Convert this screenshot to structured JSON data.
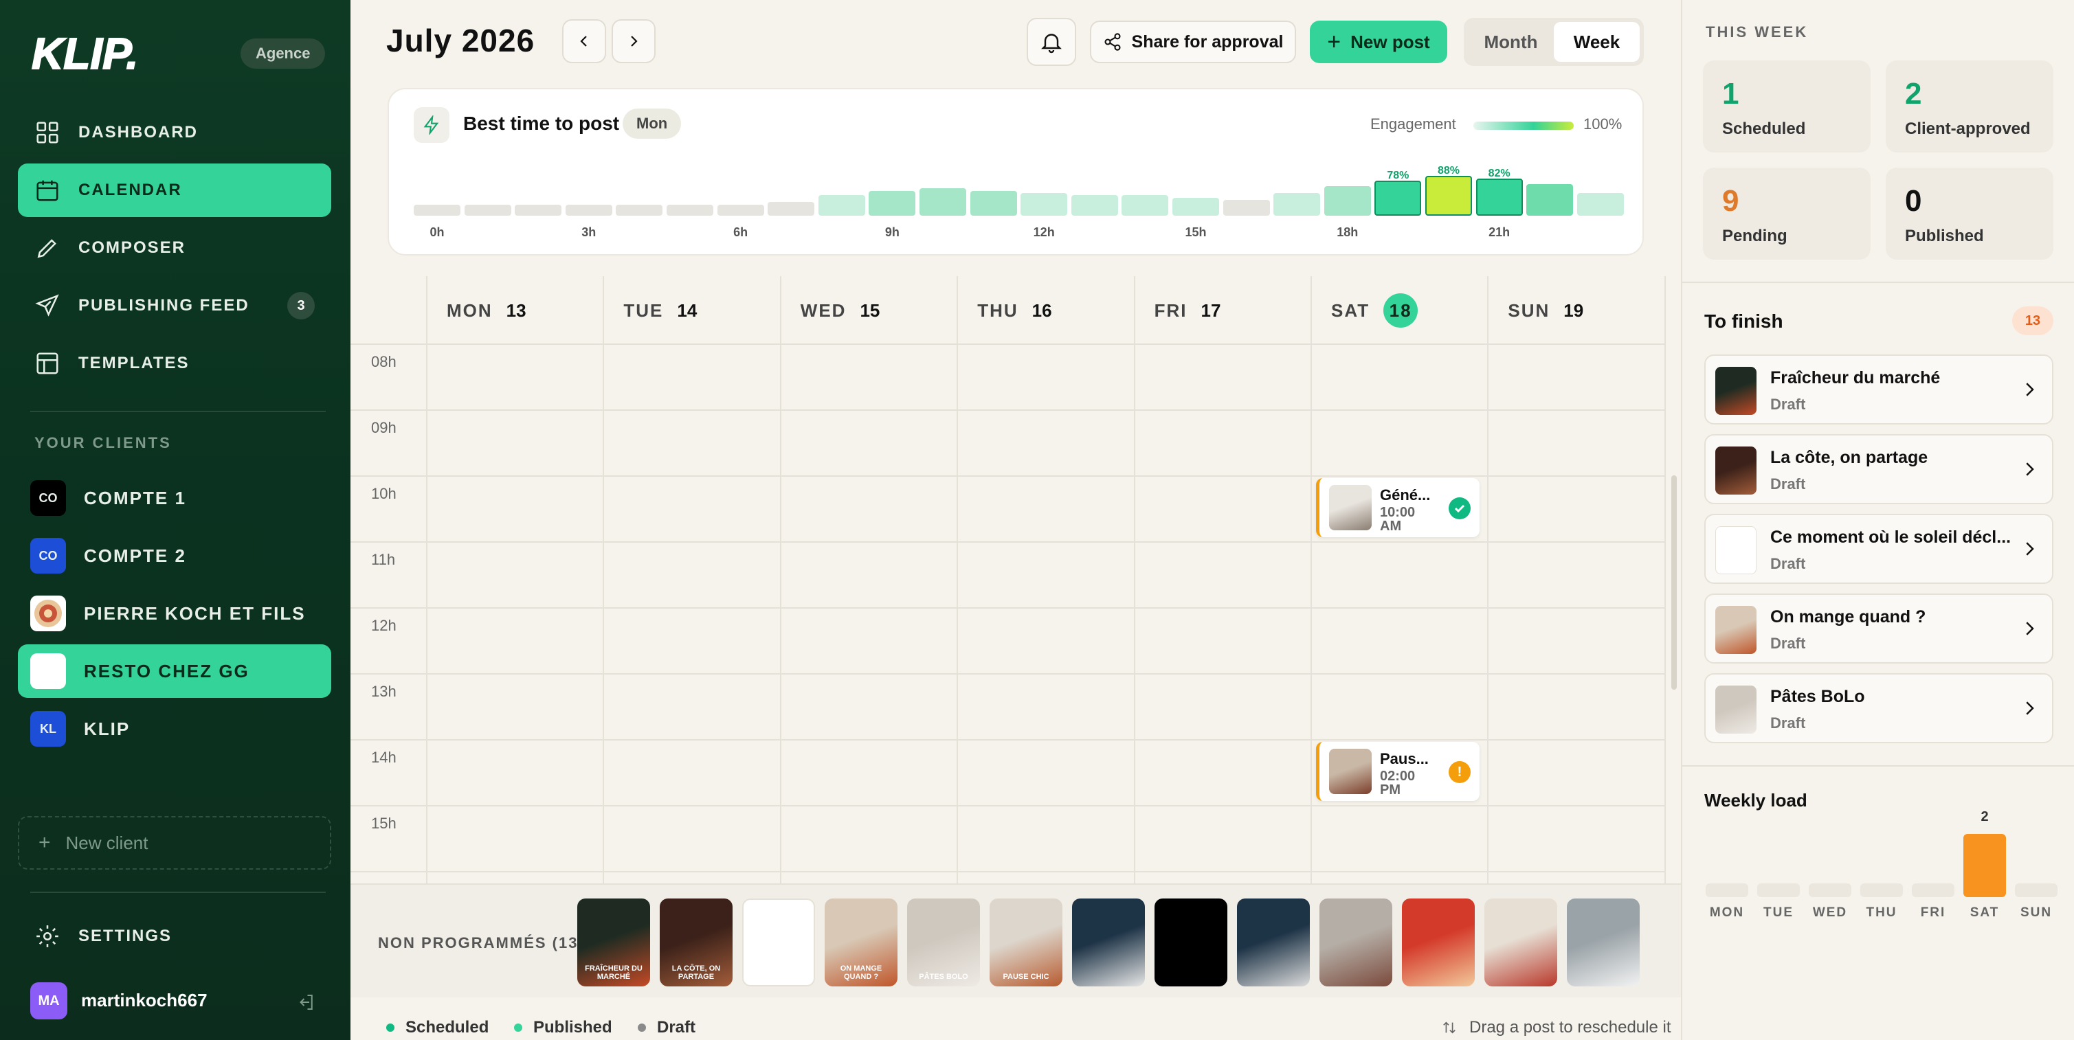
{
  "sidebar": {
    "logo": "KLIP.",
    "badge": "Agence",
    "nav": [
      {
        "label": "DASHBOARD",
        "icon": "grid-icon"
      },
      {
        "label": "CALENDAR",
        "icon": "calendar-icon"
      },
      {
        "label": "COMPOSER",
        "icon": "pencil-icon"
      },
      {
        "label": "PUBLISHING FEED",
        "icon": "send-icon",
        "count": "3"
      },
      {
        "label": "TEMPLATES",
        "icon": "layout-icon"
      }
    ],
    "clients_label": "YOUR CLIENTS",
    "clients": [
      {
        "label": "COMPTE 1",
        "initials": "CO",
        "color": "#000000"
      },
      {
        "label": "COMPTE 2",
        "initials": "CO",
        "color": "#1d4ed8"
      },
      {
        "label": "PIERRE KOCH ET FILS",
        "initials": "",
        "color": "#ffffff"
      },
      {
        "label": "RESTO CHEZ GG",
        "initials": "",
        "color": "#ffffff"
      },
      {
        "label": "KLIP",
        "initials": "KL",
        "color": "#1d4ed8"
      }
    ],
    "new_client": "New client",
    "settings": "SETTINGS",
    "user": {
      "initials": "MA",
      "name": "martinkoch667"
    }
  },
  "header": {
    "title": "July 2026",
    "share_label": "Share for approval",
    "new_post_label": "New post",
    "view_month": "Month",
    "view_week": "Week"
  },
  "best_time": {
    "title": "Best time to post",
    "day": "Mon",
    "engagement_label": "Engagement",
    "engagement_max": "100%",
    "hours": [
      0,
      1,
      2,
      3,
      4,
      5,
      6,
      7,
      8,
      9,
      10,
      11,
      12,
      13,
      14,
      15,
      16,
      17,
      18,
      19,
      20,
      21,
      22,
      23
    ],
    "values": [
      0.2,
      0.2,
      0.2,
      0.2,
      0.2,
      0.2,
      0.2,
      0.3,
      0.45,
      0.55,
      0.6,
      0.55,
      0.5,
      0.45,
      0.45,
      0.4,
      0.35,
      0.5,
      0.65,
      0.78,
      0.88,
      0.82,
      0.7,
      0.5
    ],
    "peak_labels": {
      "19": "78%",
      "20": "88%",
      "21": "82%"
    },
    "tick_labels": [
      "0h",
      "3h",
      "6h",
      "9h",
      "12h",
      "15h",
      "18h",
      "21h"
    ]
  },
  "calendar": {
    "days": [
      {
        "dow": "MON",
        "num": "13"
      },
      {
        "dow": "TUE",
        "num": "14"
      },
      {
        "dow": "WED",
        "num": "15"
      },
      {
        "dow": "THU",
        "num": "16"
      },
      {
        "dow": "FRI",
        "num": "17"
      },
      {
        "dow": "SAT",
        "num": "18",
        "today": true
      },
      {
        "dow": "SUN",
        "num": "19"
      }
    ],
    "hours": [
      "08h",
      "09h",
      "10h",
      "11h",
      "12h",
      "13h",
      "14h",
      "15h"
    ],
    "events": [
      {
        "title": "Géné...",
        "time": "10:00 AM",
        "time1": "10:00",
        "time2": "AM",
        "status": "approved",
        "day": "SAT",
        "hour": "10h"
      },
      {
        "title": "Paus...",
        "time": "02:00 PM",
        "time1": "02:00",
        "time2": "PM",
        "status": "pending",
        "day": "SAT",
        "hour": "14h"
      }
    ]
  },
  "tray": {
    "label": "NON PROGRAMMÉS (13)",
    "thumbs": [
      {
        "colors": [
          "#1f2b22",
          "#c44a26"
        ],
        "caption": "FRAÎCHEUR DU MARCHÉ"
      },
      {
        "colors": [
          "#3b2119",
          "#a35d3a"
        ],
        "caption": "LA CÔTE, ON PARTAGE"
      },
      {
        "colors": [
          "#ffffff",
          "#ffffff"
        ],
        "caption": ""
      },
      {
        "colors": [
          "#d8c8b5",
          "#c0562a"
        ],
        "caption": "ON MANGE QUAND ?"
      },
      {
        "colors": [
          "#cfc8bf",
          "#eeeae4"
        ],
        "caption": "PÂTES BOLO"
      },
      {
        "colors": [
          "#ddd6cc",
          "#b75b2f"
        ],
        "caption": "PAUSE CHIC"
      },
      {
        "colors": [
          "#1d3346",
          "#e7e7e7"
        ],
        "caption": ""
      },
      {
        "colors": [
          "#000000",
          "#000000"
        ],
        "caption": ""
      },
      {
        "colors": [
          "#1d3346",
          "#dcdcdc"
        ],
        "caption": ""
      },
      {
        "colors": [
          "#b5aea6",
          "#7b4a3c"
        ],
        "caption": ""
      },
      {
        "colors": [
          "#d43a2a",
          "#f2c89a"
        ],
        "caption": ""
      },
      {
        "colors": [
          "#e7dfd4",
          "#b8382a"
        ],
        "caption": ""
      },
      {
        "colors": [
          "#9aa3a8",
          "#f2f2f2"
        ],
        "caption": ""
      }
    ]
  },
  "legend": {
    "items": [
      {
        "label": "Scheduled",
        "color": "#10b981"
      },
      {
        "label": "Published",
        "color": "#34d399"
      },
      {
        "label": "Draft",
        "color": "#8a8a8a"
      }
    ],
    "drag_hint": "Drag a post to reschedule it"
  },
  "right": {
    "week_label": "THIS WEEK",
    "stats": [
      {
        "value": "1",
        "label": "Scheduled",
        "color": "#10a36c"
      },
      {
        "value": "2",
        "label": "Client-approved",
        "color": "#10a36c"
      },
      {
        "value": "9",
        "label": "Pending",
        "color": "#e07a2b"
      },
      {
        "value": "0",
        "label": "Published",
        "color": "#111111"
      }
    ],
    "to_finish_title": "To finish",
    "to_finish_count": "13",
    "to_finish": [
      {
        "title": "Fraîcheur du marché",
        "status": "Draft",
        "colors": [
          "#1f2b22",
          "#c44a26"
        ]
      },
      {
        "title": "La côte, on partage",
        "status": "Draft",
        "colors": [
          "#3b2119",
          "#a35d3a"
        ]
      },
      {
        "title": "Ce moment où le soleil décl...",
        "status": "Draft",
        "colors": [
          "#ffffff",
          "#ffffff"
        ]
      },
      {
        "title": "On mange quand ?",
        "status": "Draft",
        "colors": [
          "#d8c8b5",
          "#c0562a"
        ]
      },
      {
        "title": "Pâtes BoLo",
        "status": "Draft",
        "colors": [
          "#cfc8bf",
          "#eeeae4"
        ]
      }
    ],
    "weekly_load_title": "Weekly load",
    "weekly_load": {
      "days": [
        "MON",
        "TUE",
        "WED",
        "THU",
        "FRI",
        "SAT",
        "SUN"
      ],
      "values": [
        0,
        0,
        0,
        0,
        0,
        2,
        0
      ],
      "peak_label": "2"
    }
  }
}
